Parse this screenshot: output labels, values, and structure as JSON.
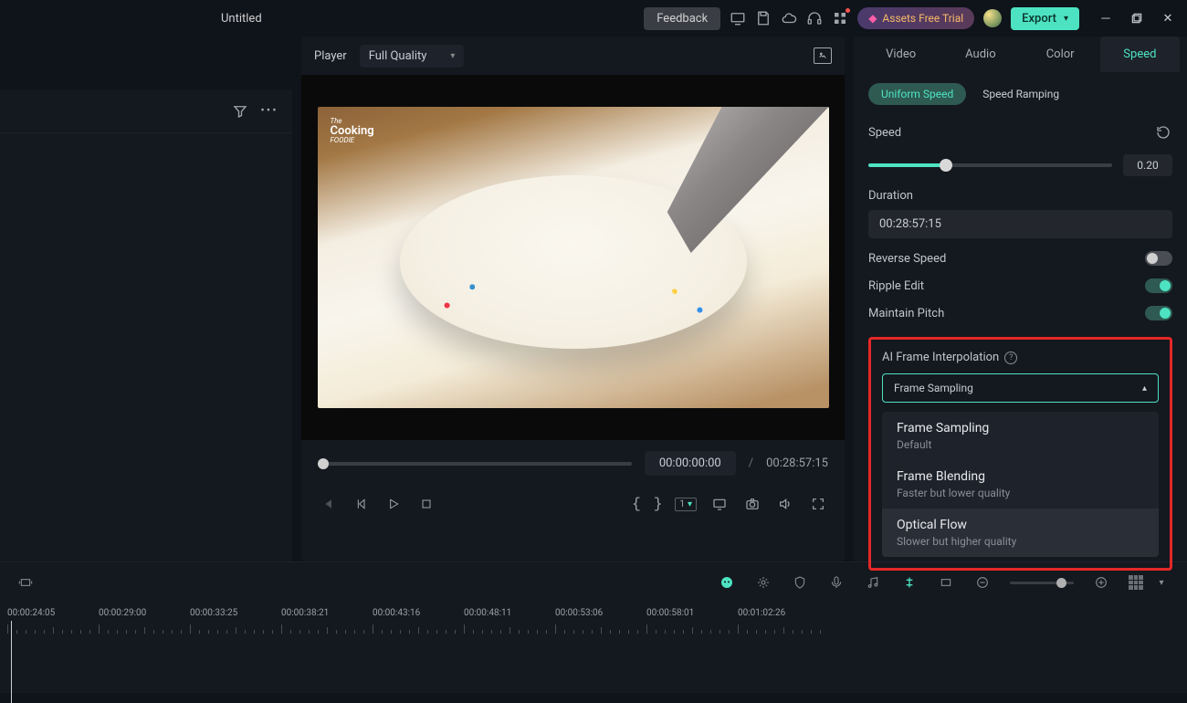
{
  "titlebar": {
    "title": "Untitled",
    "feedback": "Feedback",
    "assets_trial": "Assets Free Trial",
    "export": "Export"
  },
  "player": {
    "label": "Player",
    "quality": "Full Quality",
    "current_time": "00:00:00:00",
    "separator": "/",
    "total_time": "00:28:57:15"
  },
  "right_panel": {
    "tabs": [
      "Video",
      "Audio",
      "Color",
      "Speed"
    ],
    "active_tab": "Speed",
    "subtabs": {
      "uniform": "Uniform Speed",
      "ramping": "Speed Ramping"
    },
    "speed_label": "Speed",
    "speed_value": "0.20",
    "duration_label": "Duration",
    "duration_value": "00:28:57:15",
    "reverse_label": "Reverse Speed",
    "ripple_label": "Ripple Edit",
    "pitch_label": "Maintain Pitch",
    "ai_label": "AI Frame Interpolation",
    "dropdown_selected": "Frame Sampling",
    "dropdown_items": [
      {
        "title": "Frame Sampling",
        "sub": "Default"
      },
      {
        "title": "Frame Blending",
        "sub": "Faster but lower quality"
      },
      {
        "title": "Optical Flow",
        "sub": "Slower but higher quality"
      }
    ]
  },
  "timeline": {
    "labels": [
      "00:00:24:05",
      "00:00:29:00",
      "00:00:33:25",
      "00:00:38:21",
      "00:00:43:16",
      "00:00:48:11",
      "00:00:53:06",
      "00:00:58:01",
      "00:01:02:26"
    ]
  },
  "media_brand": {
    "line1": "The",
    "line2": "Cooking",
    "line3": "FOODIE"
  }
}
